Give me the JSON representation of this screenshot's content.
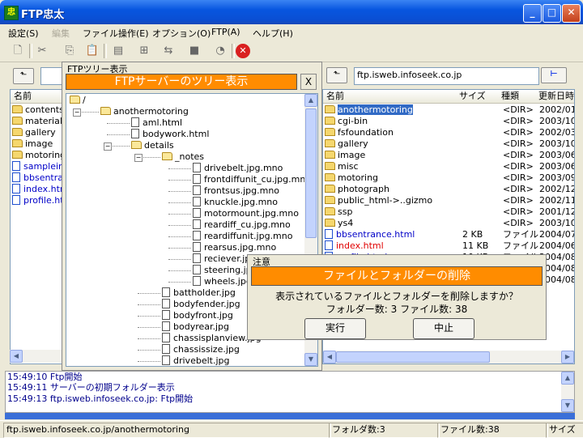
{
  "window": {
    "title": "FTP忠太",
    "icon": "ftp-app-icon"
  },
  "menu": [
    "設定(S)",
    "編集",
    "ファイル操作(E)",
    "オプション(O)",
    "FTP(A)",
    "ヘルプ(H)"
  ],
  "local_col_header": "名前",
  "local_files": [
    {
      "name": "contents",
      "type": "folder"
    },
    {
      "name": "material",
      "type": "folder"
    },
    {
      "name": "gallery",
      "type": "folder"
    },
    {
      "name": "image",
      "type": "folder"
    },
    {
      "name": "motoring",
      "type": "folder"
    },
    {
      "name": "samplein",
      "type": "file"
    },
    {
      "name": "bbsentra",
      "type": "file"
    },
    {
      "name": "index.htm",
      "type": "file"
    },
    {
      "name": "profile.ht",
      "type": "file"
    }
  ],
  "remote": {
    "address": "ftp.isweb.infoseek.co.jp",
    "columns": [
      "名前",
      "サイズ",
      "種類",
      "更新日時"
    ],
    "rows": [
      {
        "name": "anothermotoring",
        "size": "",
        "kind": "<DIR>",
        "date": "2002/01"
      },
      {
        "name": "cgi-bin",
        "size": "",
        "kind": "<DIR>",
        "date": "2003/10"
      },
      {
        "name": "fsfoundation",
        "size": "",
        "kind": "<DIR>",
        "date": "2002/03"
      },
      {
        "name": "gallery",
        "size": "",
        "kind": "<DIR>",
        "date": "2003/10"
      },
      {
        "name": "image",
        "size": "",
        "kind": "<DIR>",
        "date": "2003/06"
      },
      {
        "name": "misc",
        "size": "",
        "kind": "<DIR>",
        "date": "2003/06"
      },
      {
        "name": "motoring",
        "size": "",
        "kind": "<DIR>",
        "date": "2003/09"
      },
      {
        "name": "photograph",
        "size": "",
        "kind": "<DIR>",
        "date": "2002/12"
      },
      {
        "name": "public_html->..gizmo",
        "size": "",
        "kind": "<DIR>",
        "date": "2002/11"
      },
      {
        "name": "ssp",
        "size": "",
        "kind": "<DIR>",
        "date": "2001/12"
      },
      {
        "name": "ys4",
        "size": "",
        "kind": "<DIR>",
        "date": "2003/10"
      },
      {
        "name": "bbsentrance.html",
        "size": "2 KB",
        "kind": "ファイル",
        "date": "2004/07"
      },
      {
        "name": "index.html",
        "size": "11 KB",
        "kind": "ファイル",
        "date": "2004/06"
      },
      {
        "name": "profile.html",
        "size": "10 KB",
        "kind": "ファイル",
        "date": "2004/08"
      },
      {
        "name": "",
        "size": "",
        "kind": "",
        "date": "2004/08"
      },
      {
        "name": "",
        "size": "",
        "kind": "",
        "date": "2004/08"
      }
    ]
  },
  "tree": {
    "label": "FTPツリー表示",
    "header": "FTPサーバーのツリー表示",
    "close": "X",
    "nodes": [
      {
        "text": "/",
        "kind": "folder-open",
        "depth": 0
      },
      {
        "text": "anothermotoring",
        "kind": "folder-open",
        "depth": 1
      },
      {
        "text": "aml.html",
        "kind": "file",
        "depth": 2
      },
      {
        "text": "bodywork.html",
        "kind": "file",
        "depth": 2
      },
      {
        "text": "details",
        "kind": "folder-open",
        "depth": 2
      },
      {
        "text": "_notes",
        "kind": "folder-open",
        "depth": 3
      },
      {
        "text": "drivebelt.jpg.mno",
        "kind": "file",
        "depth": 4
      },
      {
        "text": "frontdiffunit_cu.jpg.mno",
        "kind": "file",
        "depth": 4
      },
      {
        "text": "frontsus.jpg.mno",
        "kind": "file",
        "depth": 4
      },
      {
        "text": "knuckle.jpg.mno",
        "kind": "file",
        "depth": 4
      },
      {
        "text": "motormount.jpg.mno",
        "kind": "file",
        "depth": 4
      },
      {
        "text": "reardiff_cu.jpg.mno",
        "kind": "file",
        "depth": 4
      },
      {
        "text": "reardiffunit.jpg.mno",
        "kind": "file",
        "depth": 4
      },
      {
        "text": "rearsus.jpg.mno",
        "kind": "file",
        "depth": 4
      },
      {
        "text": "reciever.jpg",
        "kind": "file",
        "depth": 4
      },
      {
        "text": "steering.jpg",
        "kind": "file",
        "depth": 4
      },
      {
        "text": "wheels.jpg",
        "kind": "file",
        "depth": 4
      },
      {
        "text": "battholder.jpg",
        "kind": "file",
        "depth": 3
      },
      {
        "text": "bodyfender.jpg",
        "kind": "file",
        "depth": 3
      },
      {
        "text": "bodyfront.jpg",
        "kind": "file",
        "depth": 3
      },
      {
        "text": "bodyrear.jpg",
        "kind": "file",
        "depth": 3
      },
      {
        "text": "chassisplanview.jpg",
        "kind": "file",
        "depth": 3
      },
      {
        "text": "chassissize.jpg",
        "kind": "file",
        "depth": 3
      },
      {
        "text": "drivebelt.jpg",
        "kind": "file",
        "depth": 3
      }
    ]
  },
  "dialog": {
    "caption": "注意",
    "title": "ファイルとフォルダーの削除",
    "message": "表示されているファイルとフォルダーを削除しますか？",
    "counts": "フォルダー数: 3  ファイル数: 38",
    "ok": "実行",
    "cancel": "中止"
  },
  "log": [
    "15:49:10  Ftp開始",
    "15:49:11  サーバーの初期フォルダー表示",
    "15:49:13  ftp.isweb.infoseek.co.jp: Ftp開始"
  ],
  "status": {
    "path": "ftp.isweb.infoseek.co.jp/anothermotoring",
    "folders": "フォルダ数:3",
    "files": "ファイル数:38",
    "size": "サイズ"
  }
}
